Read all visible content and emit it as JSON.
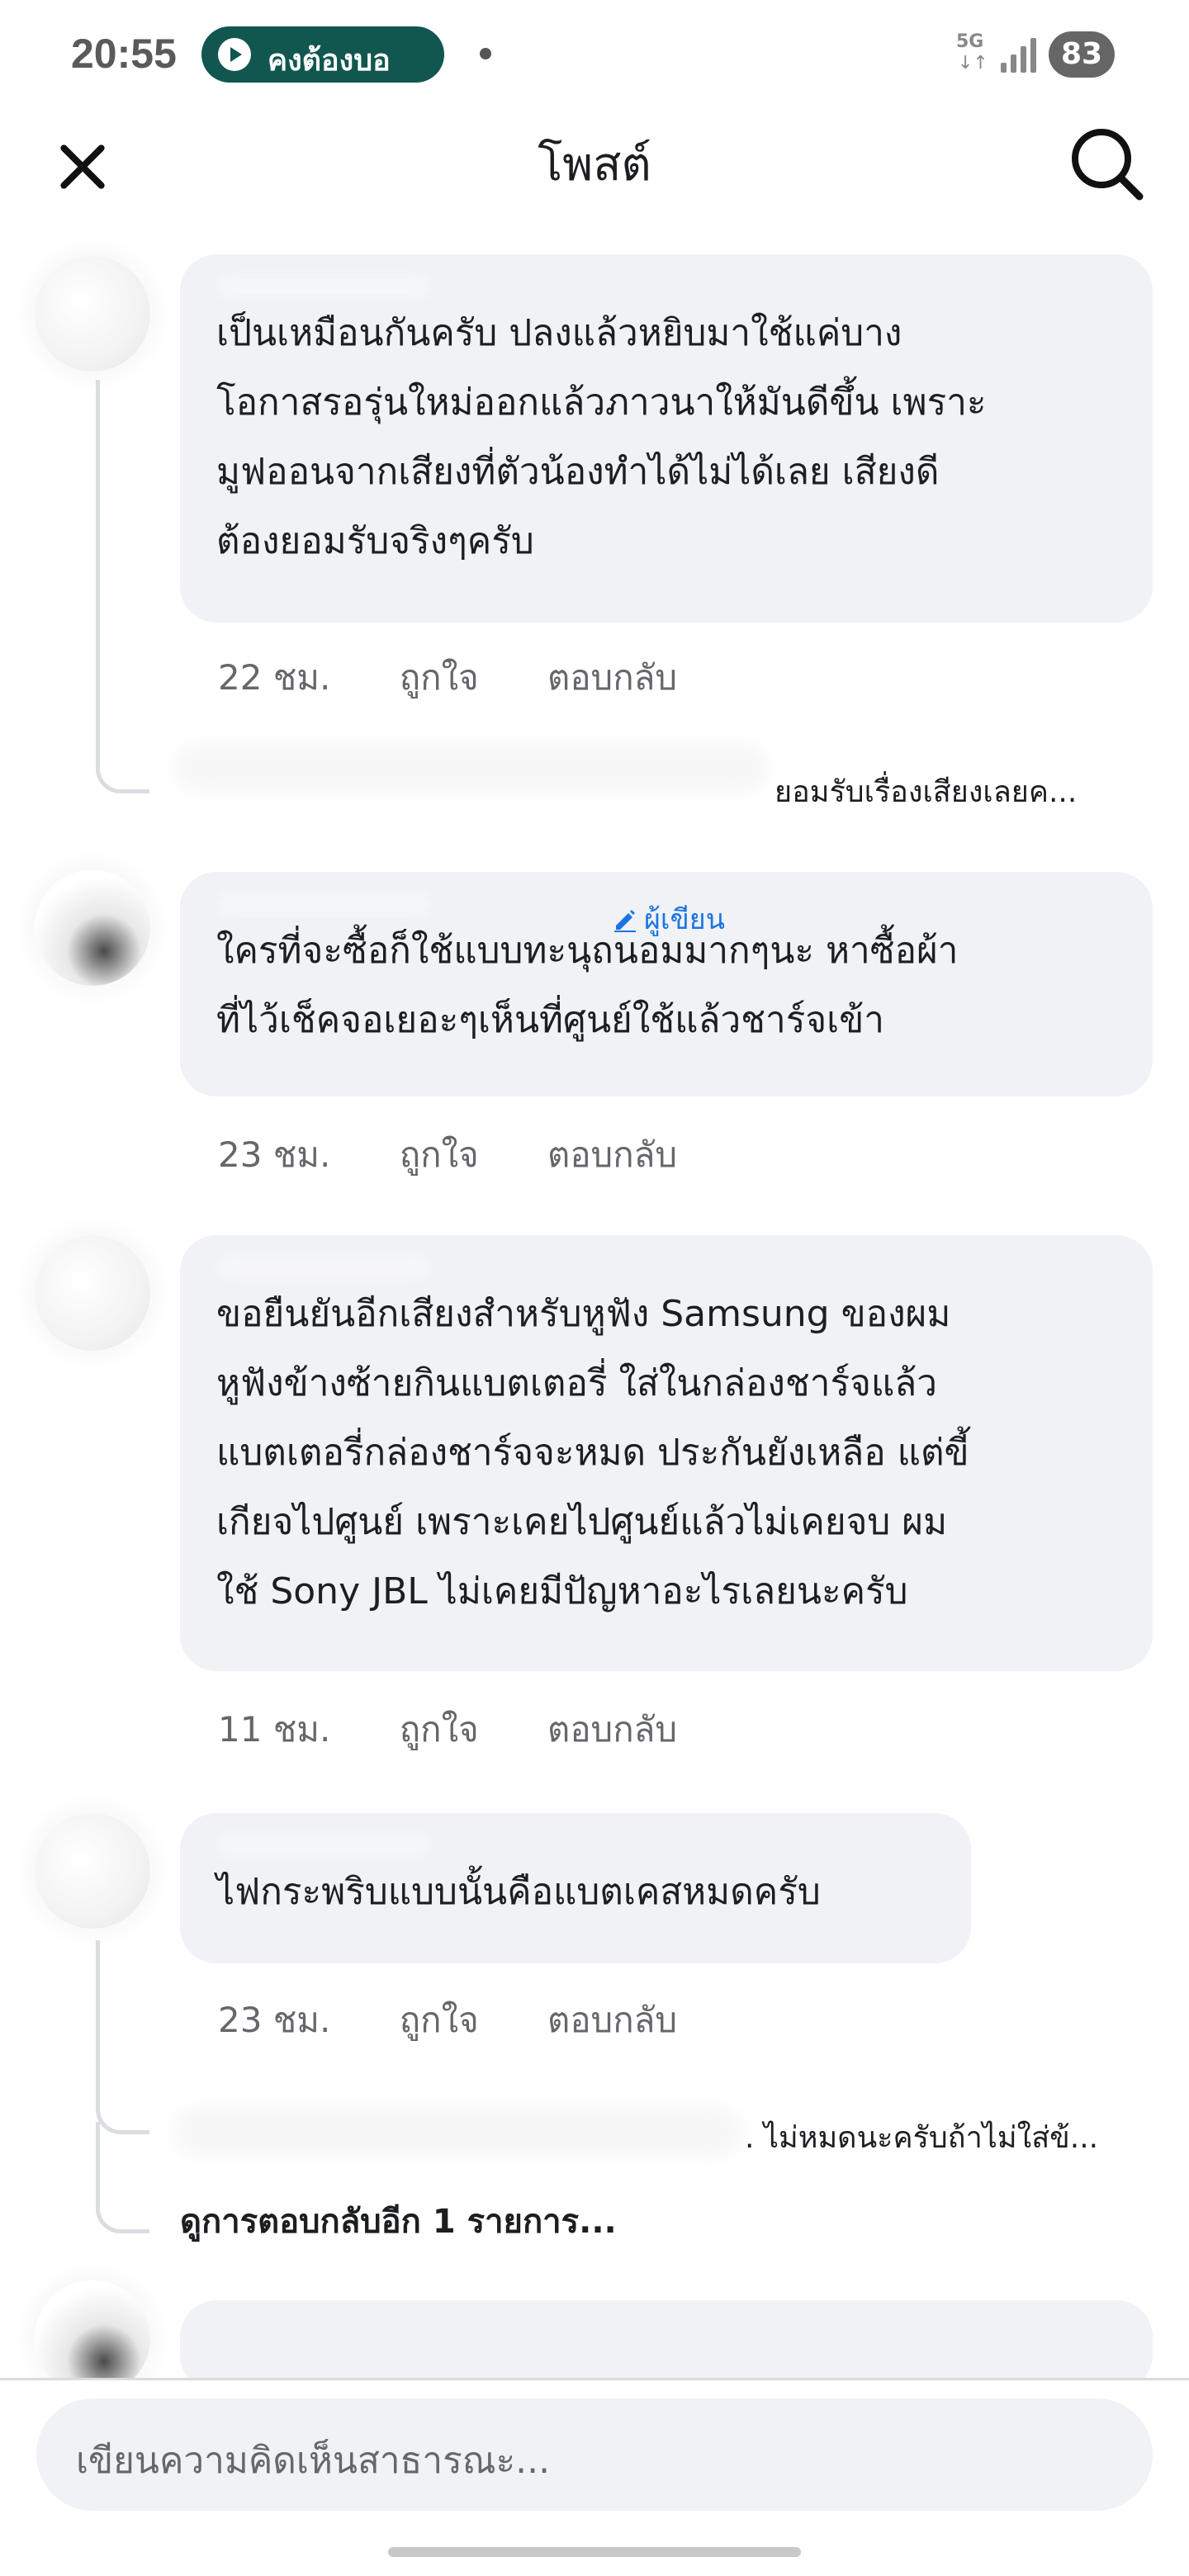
{
  "status_bar": {
    "time": "20:55",
    "media_label": "คงต้องบอ",
    "network": "5G",
    "network_arrows": "↓↑",
    "battery": "83"
  },
  "header": {
    "title": "โพสต์"
  },
  "comments": [
    {
      "text": "เป็นเหมือนกันครับ ปลงแล้วหยิบมาใช้แค่บาง\nโอกาสรอรุ่นใหม่ออกแล้วภาวนาให้มันดีขึ้น เพราะ\nมูฟออนจากเสียงที่ตัวน้องทำได้ไม่ได้เลย เสียงดี\nต้องยอมรับจริงๆครับ",
      "time": "22 ชม.",
      "like": "ถูกใจ",
      "reply": "ตอบกลับ",
      "reply_preview": "ยอมรับเรื่องเสียงเลยค..."
    },
    {
      "author_badge": "ผู้เขียน",
      "text": "ใครที่จะซื้อก็ใช้แบบทะนุถนอมมากๆนะ หาซื้อผ้า\nที่ไว้เช็คจอเยอะๆเห็นที่ศูนย์ใช้แล้วชาร์จเข้า",
      "time": "23 ชม.",
      "like": "ถูกใจ",
      "reply": "ตอบกลับ"
    },
    {
      "text": "ขอยืนยันอีกเสียงสำหรับหูฟัง Samsung ของผม\nหูฟังข้างซ้ายกินแบตเตอรี่ ใส่ในกล่องชาร์จแล้ว\nแบตเตอรี่กล่องชาร์จจะหมด ประกันยังเหลือ แต่ขี้\nเกียจไปศูนย์ เพราะเคยไปศูนย์แล้วไม่เคยจบ ผม\nใช้ Sony JBL ไม่เคยมีปัญหาอะไรเลยนะครับ",
      "time": "11 ชม.",
      "like": "ถูกใจ",
      "reply": "ตอบกลับ"
    },
    {
      "text": "ไฟกระพริบแบบนั้นคือแบตเคสหมดครับ",
      "time": "23 ชม.",
      "like": "ถูกใจ",
      "reply": "ตอบกลับ",
      "reply_preview": ". ไม่หมดนะครับถ้าไม่ใส่ข้...",
      "more_replies": "ดูการตอบกลับอีก 1 รายการ..."
    }
  ],
  "composer": {
    "placeholder": "เขียนความคิดเห็นสาธารณะ..."
  }
}
